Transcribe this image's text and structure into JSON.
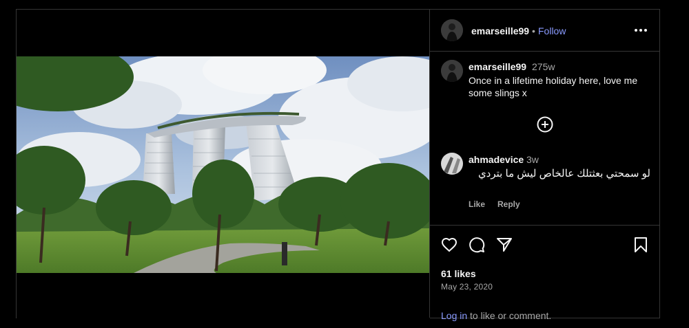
{
  "post": {
    "author": "emarseille99",
    "separator": "•",
    "follow_label": "Follow",
    "more_icon": "more-horizontal-icon"
  },
  "caption": {
    "username": "emarseille99",
    "time": "275w",
    "text": "Once in a lifetime holiday here, love me some slings x"
  },
  "comments": [
    {
      "username": "ahmadevice",
      "time": "3w",
      "text": "لو سمحتي بعثتلك عالخاص ليش ما بتردي",
      "like_label": "Like",
      "reply_label": "Reply"
    }
  ],
  "actions": {
    "icons": [
      "heart-icon",
      "comment-icon",
      "share-icon",
      "bookmark-icon"
    ],
    "likes": "61 likes",
    "date": "May 23, 2020",
    "login_link": "Log in",
    "login_suffix": " to like or comment."
  },
  "colors": {
    "background": "#000000",
    "border": "#363636",
    "link": "#8a9bff",
    "secondary_text": "#a8a8a8"
  }
}
